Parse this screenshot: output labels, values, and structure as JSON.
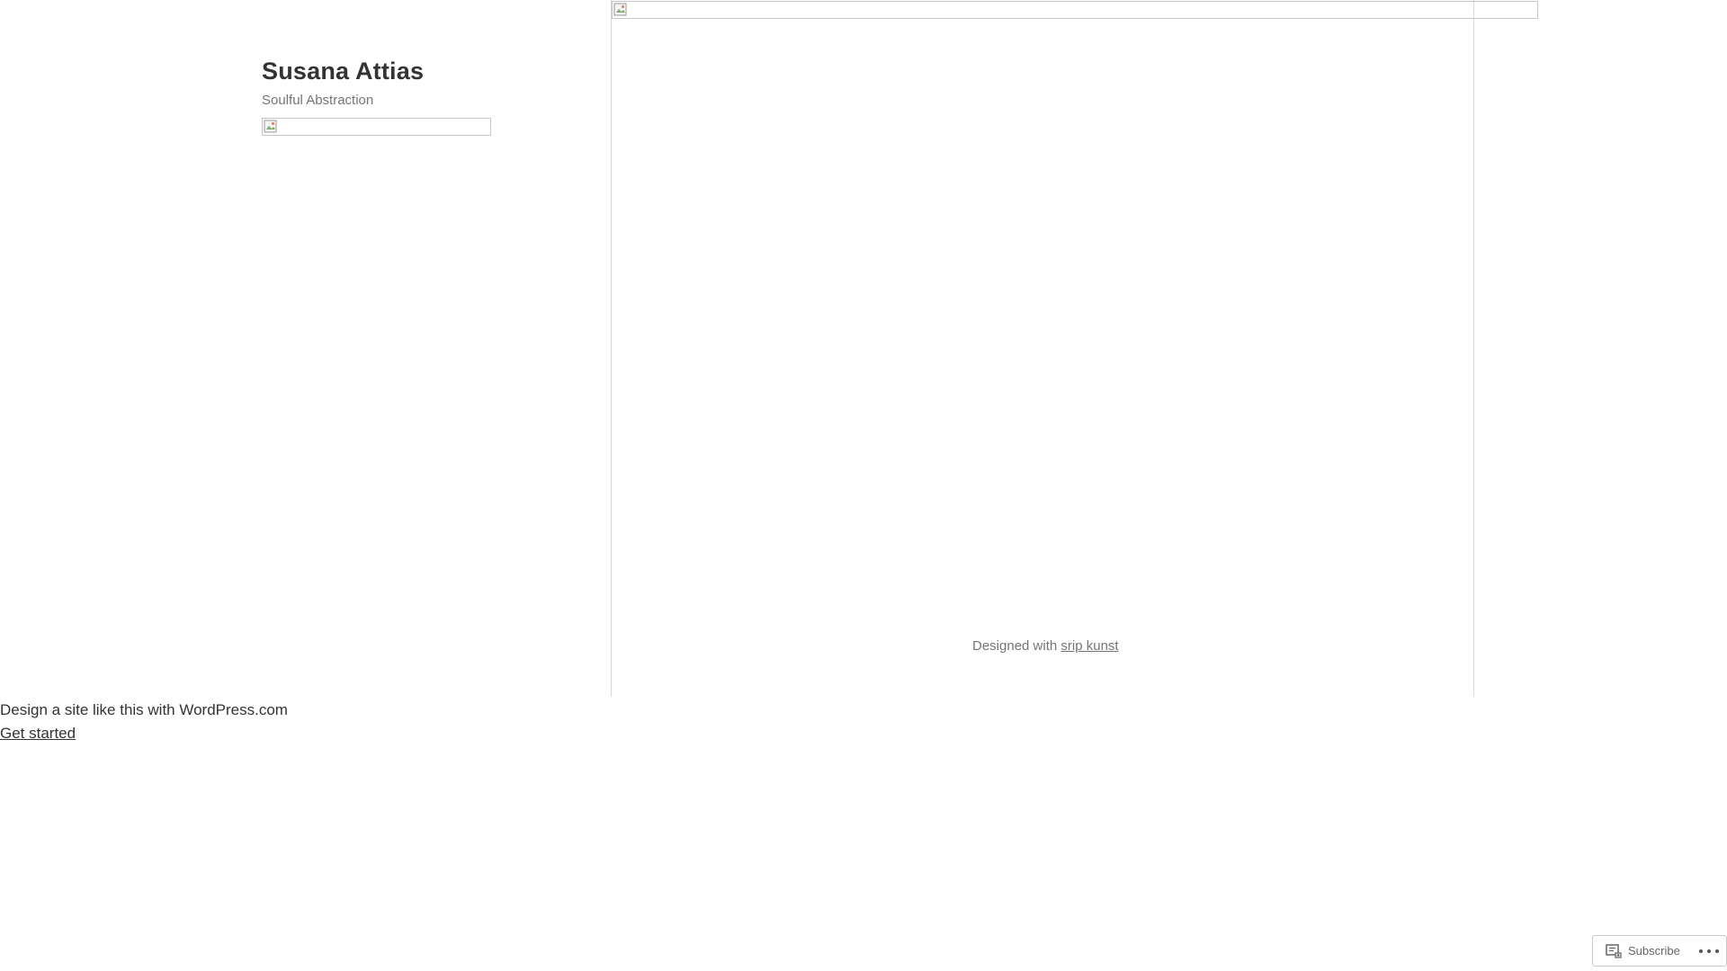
{
  "header": {
    "site_title": "Susana Attias",
    "site_description": "Soulful Abstraction"
  },
  "footer": {
    "credit_prefix": "Designed with",
    "credit_link": "srip kunst"
  },
  "wpcom_banner": {
    "text": "Design a site like this with WordPress.com",
    "cta": "Get started"
  },
  "action_bar": {
    "subscribe_label": "Subscribe",
    "more_icon": "ellipsis-icon",
    "subscribe_icon": "reader-icon"
  },
  "icons": {
    "broken_image": "broken-image-icon"
  }
}
